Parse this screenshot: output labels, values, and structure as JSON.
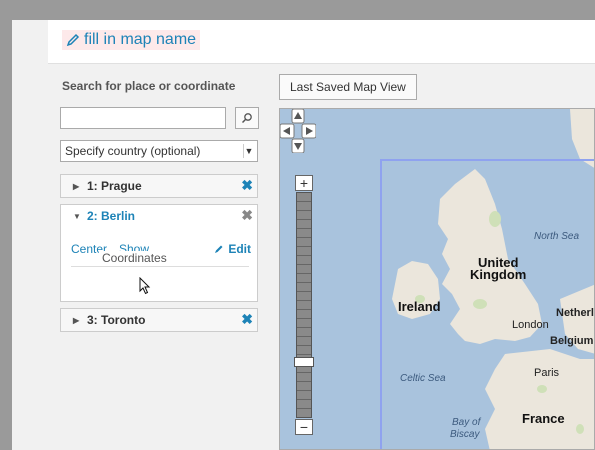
{
  "dialog": {
    "title": "fill in map name"
  },
  "search": {
    "label": "Search for place or coordinate",
    "input_value": "",
    "country_select": "Specify country (optional)"
  },
  "locations": [
    {
      "label": "1: Prague",
      "expanded": false
    },
    {
      "label": "2: Berlin",
      "expanded": true,
      "actions": {
        "center": "Center",
        "show": "Show",
        "edit": "Edit"
      },
      "coordinates_label": "Coordinates"
    },
    {
      "label": "3: Toronto",
      "expanded": false
    }
  ],
  "map_controls": {
    "last_saved": "Last Saved Map View",
    "zoom_in": "+",
    "zoom_out": "−"
  },
  "map": {
    "labels": {
      "united": "United",
      "kingdom": "Kingdom",
      "ireland": "Ireland",
      "london": "London",
      "north_sea": "North Sea",
      "netherlands": "Netherl",
      "belgium": "Belgium",
      "paris": "Paris",
      "celtic_sea": "Celtic Sea",
      "france": "France",
      "bay_of": "Bay of",
      "biscay": "Biscay"
    }
  },
  "colors": {
    "accent": "#1d83b7",
    "title_bg": "#fde9ea",
    "sea": "#a9c3dd",
    "land": "#ebe6dc"
  }
}
